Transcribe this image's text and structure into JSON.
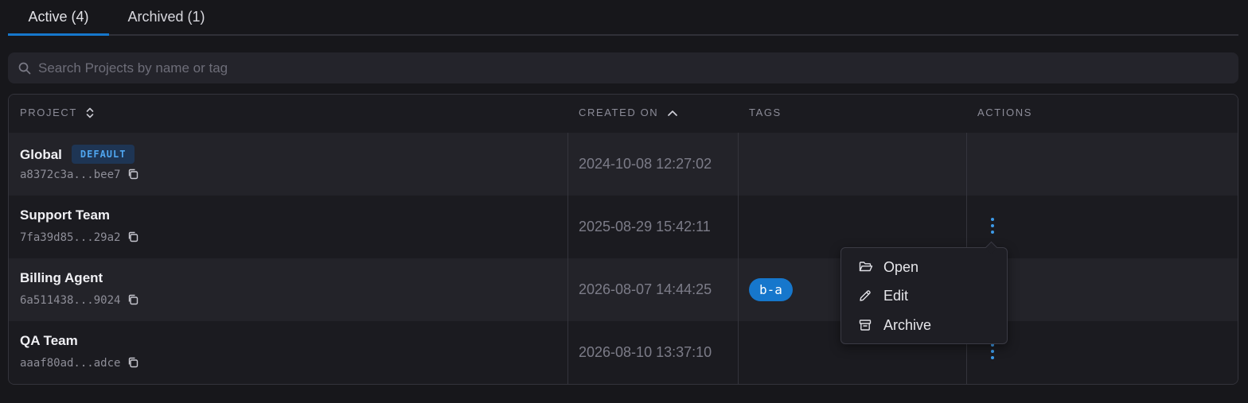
{
  "tabs": [
    {
      "label": "Active (4)",
      "active": true
    },
    {
      "label": "Archived (1)",
      "active": false
    }
  ],
  "search": {
    "placeholder": "Search Projects by name or tag",
    "value": ""
  },
  "table": {
    "headers": [
      "PROJECT",
      "CREATED ON",
      "TAGS",
      "ACTIONS"
    ],
    "sort": {
      "project": "unsorted",
      "created_on": "ascending"
    },
    "rows": [
      {
        "name": "Global",
        "badge": "DEFAULT",
        "id": "a8372c3a...bee7",
        "created": "2024-10-08 12:27:02",
        "tag": "",
        "has_actions": false
      },
      {
        "name": "Support Team",
        "badge": "",
        "id": "7fa39d85...29a2",
        "created": "2025-08-29 15:42:11",
        "tag": "",
        "has_actions": true
      },
      {
        "name": "Billing Agent",
        "badge": "",
        "id": "6a511438...9024",
        "created": "2026-08-07 14:44:25",
        "tag": "b-a",
        "has_actions": false
      },
      {
        "name": "QA Team",
        "badge": "",
        "id": "aaaf80ad...adce",
        "created": "2026-08-10 13:37:10",
        "tag": "",
        "has_actions": true
      }
    ]
  },
  "menu": {
    "items": [
      {
        "label": "Open",
        "icon": "folder-open-icon"
      },
      {
        "label": "Edit",
        "icon": "pencil-icon"
      },
      {
        "label": "Archive",
        "icon": "archive-box-icon"
      }
    ]
  },
  "colors": {
    "background": "#17171b",
    "accent": "#1677cc",
    "badge_bg": "#1e3554",
    "badge_text": "#4fa6f0"
  }
}
